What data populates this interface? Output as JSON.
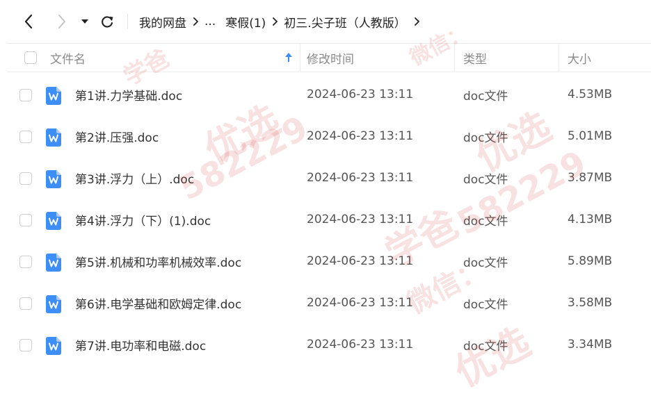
{
  "toolbar": {
    "back_icon": "chevron-left-icon",
    "forward_icon": "chevron-right-icon",
    "history_icon": "caret-down-icon",
    "refresh_icon": "refresh-icon"
  },
  "breadcrumb": {
    "items": [
      "我的网盘",
      "...",
      "寒假(1)",
      "初三.尖子班（人教版）"
    ],
    "separator_icon": "chevron-right-icon"
  },
  "table": {
    "columns": {
      "name": "文件名",
      "modified": "修改时间",
      "type": "类型",
      "size": "大小"
    },
    "sort_icon": "sort-ascending-icon",
    "file_icon": "word-doc-icon",
    "rows": [
      {
        "name": "第1讲.力学基础.doc",
        "modified": "2024-06-23 13:11",
        "type": "doc文件",
        "size": "4.53MB"
      },
      {
        "name": "第2讲.压强.doc",
        "modified": "2024-06-23 13:11",
        "type": "doc文件",
        "size": "5.01MB"
      },
      {
        "name": "第3讲.浮力（上）.doc",
        "modified": "2024-06-23 13:11",
        "type": "doc文件",
        "size": "3.87MB"
      },
      {
        "name": "第4讲.浮力（下）(1).doc",
        "modified": "2024-06-23 13:11",
        "type": "doc文件",
        "size": "4.13MB"
      },
      {
        "name": "第5讲.机械和功率机械效率.doc",
        "modified": "2024-06-23 13:11",
        "type": "doc文件",
        "size": "5.89MB"
      },
      {
        "name": "第6讲.电学基础和欧姆定律.doc",
        "modified": "2024-06-23 13:11",
        "type": "doc文件",
        "size": "3.58MB"
      },
      {
        "name": "第7讲.电功率和电磁.doc",
        "modified": "2024-06-23 13:11",
        "type": "doc文件",
        "size": "3.34MB"
      }
    ]
  },
  "watermark": {
    "texts": [
      "学爸",
      "微信：",
      "582229",
      "优选"
    ]
  },
  "colors": {
    "accent": "#3b8bf5",
    "doc_icon": "#3d8ef7",
    "watermark": "#d24646"
  }
}
